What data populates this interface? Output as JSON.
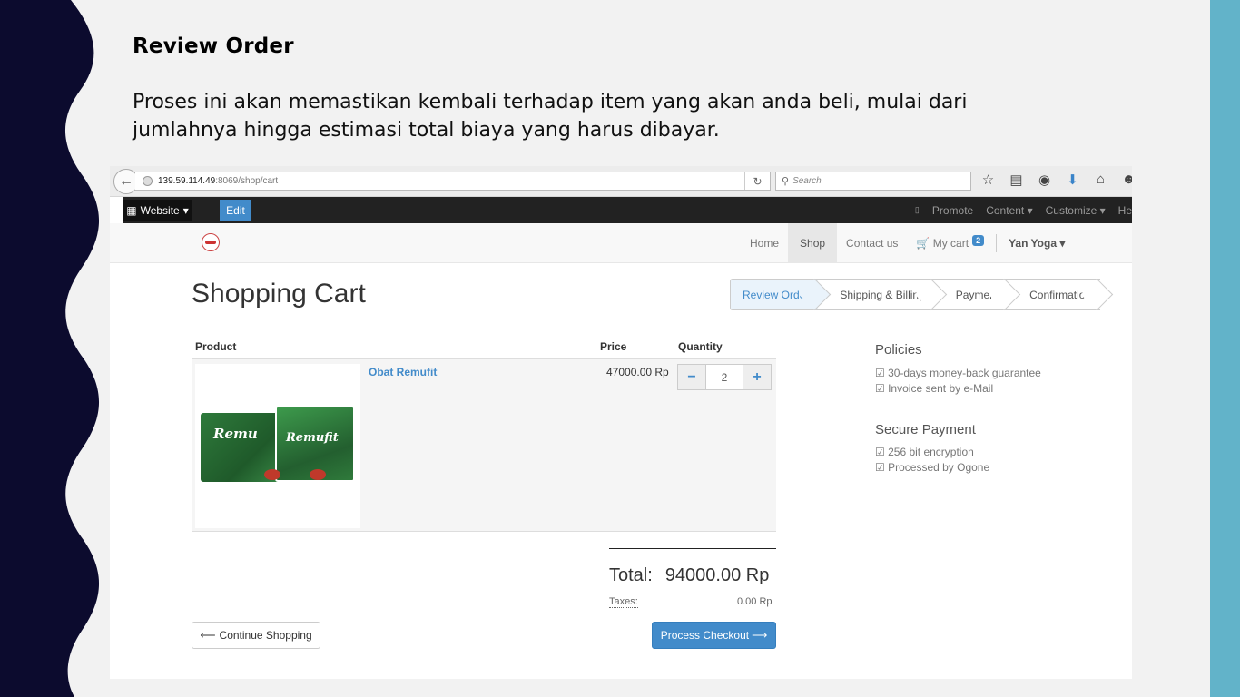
{
  "slide": {
    "title": "Review Order",
    "body": "Proses ini akan memastikan kembali terhadap item yang akan anda beli, mulai dari jumlahnya hingga estimasi total biaya yang harus dibayar."
  },
  "browser": {
    "url_host": "139.59.114.49",
    "url_path": ":8069/shop/cart",
    "search_placeholder": "Search"
  },
  "odoo_bar": {
    "website_label": "Website",
    "edit_label": "Edit",
    "promote": "Promote",
    "content": "Content",
    "customize": "Customize",
    "help_partial": "He"
  },
  "nav": {
    "home": "Home",
    "shop": "Shop",
    "contact": "Contact us",
    "cart": "My cart",
    "cart_count": "2",
    "user": "Yan Yoga"
  },
  "page": {
    "title": "Shopping Cart",
    "steps": [
      "Review Order",
      "Shipping & Billing",
      "Payment",
      "Confirmation"
    ]
  },
  "cart": {
    "headers": {
      "product": "Product",
      "price": "Price",
      "quantity": "Quantity"
    },
    "item": {
      "name": "Obat Remufit",
      "price": "47000.00 Rp",
      "quantity": "2",
      "image_text_left": "Remu",
      "image_text_right": "Remufit"
    },
    "total_label": "Total:",
    "total_value": "94000.00 Rp",
    "taxes_label": "Taxes:",
    "taxes_value": "0.00 Rp",
    "continue_label": "Continue Shopping",
    "checkout_label": "Process Checkout"
  },
  "side": {
    "policies_title": "Policies",
    "policies": [
      "☑ 30-days money-back guarantee",
      "☑ Invoice sent by e-Mail"
    ],
    "payment_title": "Secure Payment",
    "payment": [
      "☑ 256 bit encryption",
      "☑ Processed by Ogone"
    ]
  },
  "colors": {
    "slide_dark": "#0c0b2e",
    "slide_accent": "#62b3c9",
    "primary": "#428bca"
  }
}
